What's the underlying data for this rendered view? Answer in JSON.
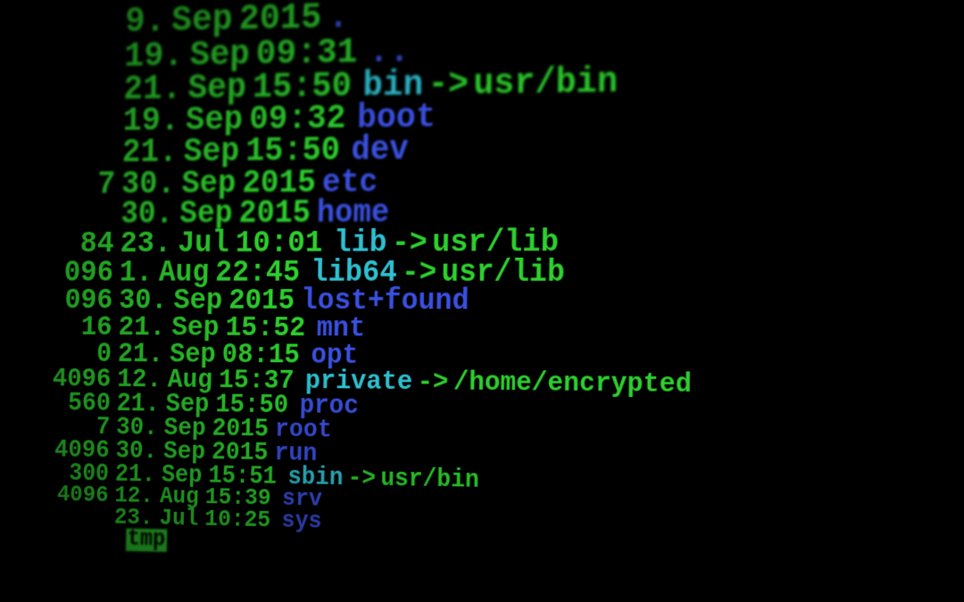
{
  "listing": [
    {
      "size": "",
      "day": "9.",
      "month": "Sep",
      "year": "2015",
      "time": "",
      "name": ".",
      "type": "dir",
      "target": ""
    },
    {
      "size": "",
      "day": "19.",
      "month": "Sep",
      "year": "",
      "time": "09:31",
      "name": "..",
      "type": "dir",
      "target": ""
    },
    {
      "size": "",
      "day": "21.",
      "month": "Sep",
      "year": "",
      "time": "15:50",
      "name": "bin",
      "type": "link",
      "target": "usr/bin"
    },
    {
      "size": "",
      "day": "19.",
      "month": "Sep",
      "year": "",
      "time": "09:32",
      "name": "boot",
      "type": "dir",
      "target": ""
    },
    {
      "size": "",
      "day": "21.",
      "month": "Sep",
      "year": "",
      "time": "15:50",
      "name": "dev",
      "type": "dir",
      "target": ""
    },
    {
      "size": "7",
      "day": "30.",
      "month": "Sep",
      "year": "2015",
      "time": "",
      "name": "etc",
      "type": "dir",
      "target": ""
    },
    {
      "size": "",
      "day": "30.",
      "month": "Sep",
      "year": "2015",
      "time": "",
      "name": "home",
      "type": "dir",
      "target": ""
    },
    {
      "size": "84",
      "day": "23.",
      "month": "Jul",
      "year": "",
      "time": "10:01",
      "name": "lib",
      "type": "link",
      "target": "usr/lib"
    },
    {
      "size": "096",
      "day": "1.",
      "month": "Aug",
      "year": "",
      "time": "22:45",
      "name": "lib64",
      "type": "link",
      "target": "usr/lib"
    },
    {
      "size": "096",
      "day": "30.",
      "month": "Sep",
      "year": "2015",
      "time": "",
      "name": "lost+found",
      "type": "dir",
      "target": ""
    },
    {
      "size": "16",
      "day": "21.",
      "month": "Sep",
      "year": "",
      "time": "15:52",
      "name": "mnt",
      "type": "dir",
      "target": ""
    },
    {
      "size": "0",
      "day": "21.",
      "month": "Sep",
      "year": "",
      "time": "08:15",
      "name": "opt",
      "type": "dir",
      "target": ""
    },
    {
      "size": "4096",
      "day": "12.",
      "month": "Aug",
      "year": "",
      "time": "15:37",
      "name": "private",
      "type": "link",
      "target": "/home/encrypted"
    },
    {
      "size": "560",
      "day": "21.",
      "month": "Sep",
      "year": "",
      "time": "15:50",
      "name": "proc",
      "type": "dir",
      "target": ""
    },
    {
      "size": "7",
      "day": "30.",
      "month": "Sep",
      "year": "2015",
      "time": "",
      "name": "root",
      "type": "dir",
      "target": ""
    },
    {
      "size": "4096",
      "day": "30.",
      "month": "Sep",
      "year": "2015",
      "time": "",
      "name": "run",
      "type": "dir",
      "target": ""
    },
    {
      "size": "300",
      "day": "21.",
      "month": "Sep",
      "year": "",
      "time": "15:51",
      "name": "sbin",
      "type": "link",
      "target": "usr/bin"
    },
    {
      "size": "4096",
      "day": "12.",
      "month": "Aug",
      "year": "",
      "time": "15:39",
      "name": "srv",
      "type": "dir",
      "target": ""
    },
    {
      "size": "",
      "day": "23.",
      "month": "Jul",
      "year": "",
      "time": "10:25",
      "name": "sys",
      "type": "dir",
      "target": ""
    },
    {
      "size": "",
      "day": "",
      "month": "",
      "year": "",
      "time": "",
      "name": "tmp",
      "type": "hl",
      "target": ""
    }
  ],
  "arrow": "->"
}
